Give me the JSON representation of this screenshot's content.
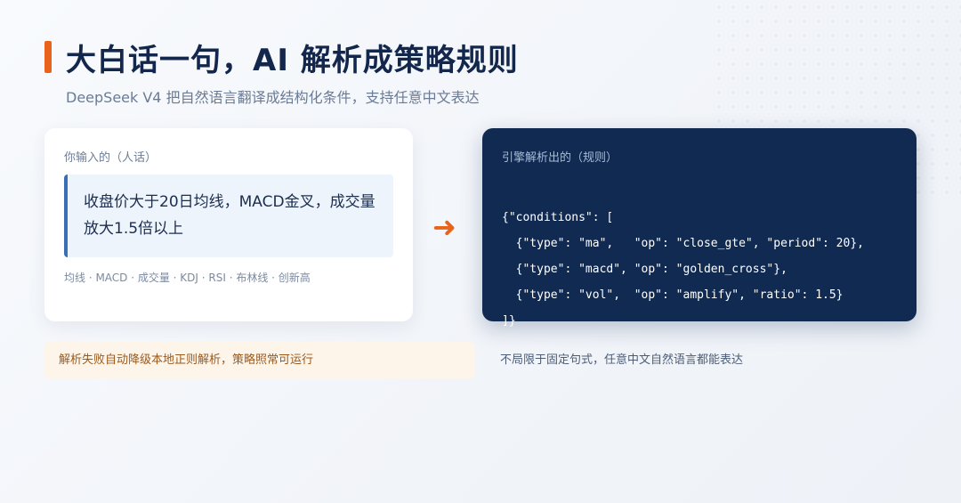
{
  "header": {
    "title": "大白话一句，AI 解析成策略规则",
    "subtitle": "DeepSeek V4 把自然语言翻译成结构化条件，支持任意中文表达"
  },
  "input_card": {
    "label": "你输入的（人话）",
    "text": "收盘价大于20日均线，MACD金叉，成交量放大1.5倍以上",
    "tags": "均线 · MACD · 成交量 · KDJ · RSI · 布林线 · 创新高"
  },
  "rule_card": {
    "label": "引擎解析出的（规则）",
    "code_lines": [
      "{\"conditions\": [",
      "  {\"type\": \"ma\",   \"op\": \"close_gte\", \"period\": 20},",
      "  {\"type\": \"macd\", \"op\": \"golden_cross\"},",
      "  {\"type\": \"vol\",  \"op\": \"amplify\", \"ratio\": 1.5}",
      "]}"
    ]
  },
  "notes": {
    "fallback": "解析失败自动降级本地正则解析，策略照常可运行",
    "freeform": "不局限于固定句式，任意中文自然语言都能表达"
  },
  "icons": {
    "arrow": "arrow-right-icon",
    "accent_bar": "title-accent-bar"
  },
  "colors": {
    "accent": "#e8641c",
    "navy": "#112a52",
    "quote_border": "#3a6fb6"
  }
}
